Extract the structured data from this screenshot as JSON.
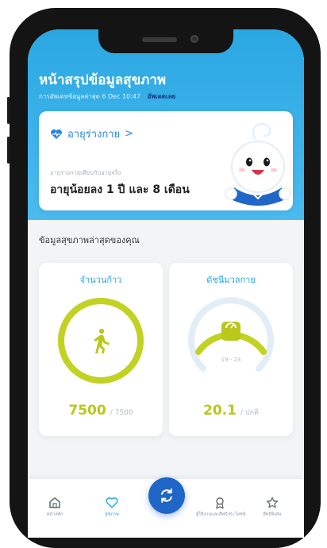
{
  "header": {
    "title": "หน้าสรุปข้อมูลสุขภาพ",
    "subtitle": "การอัพเดทข้อมูลล่าสุด 6 Dec 10:47",
    "subtitle_link": "อัพเดตเลย"
  },
  "age_card": {
    "heading": "อายุร่างกาย",
    "chevron": ">",
    "label": "อายุร่างกายเทียบกับอายุจริง",
    "value": "อายุน้อยลง 1 ปี และ 8 เดือน"
  },
  "section_title": "ข้อมูลสุขภาพล่าสุดของคุณ",
  "steps_card": {
    "title": "จำนวนก้าว",
    "value": "7500",
    "goal": "/ 7500",
    "progress": 1.0,
    "icon": "walking-icon"
  },
  "bmi_card": {
    "title": "ดัชนีมวลกาย",
    "value": "20.1",
    "status": "/ ปกติ",
    "range": "19 - 23",
    "icon": "scale-icon"
  },
  "tabbar": {
    "items": [
      {
        "label": "หน้าหลัก",
        "icon": "home-icon"
      },
      {
        "label": "สุขภาพ",
        "icon": "heart-icon"
      },
      {
        "label": "",
        "icon": "sync-icon"
      },
      {
        "label": "ผู้ใช้งานและสิทธิประโยชน์",
        "icon": "award-icon"
      },
      {
        "label": "สิทธิพิเศษ",
        "icon": "star-icon"
      }
    ]
  },
  "colors": {
    "header": "#2aa7e2",
    "accent_lime": "#b9c81a",
    "accent_blue": "#2a84d6",
    "fab": "#1f66c6"
  }
}
